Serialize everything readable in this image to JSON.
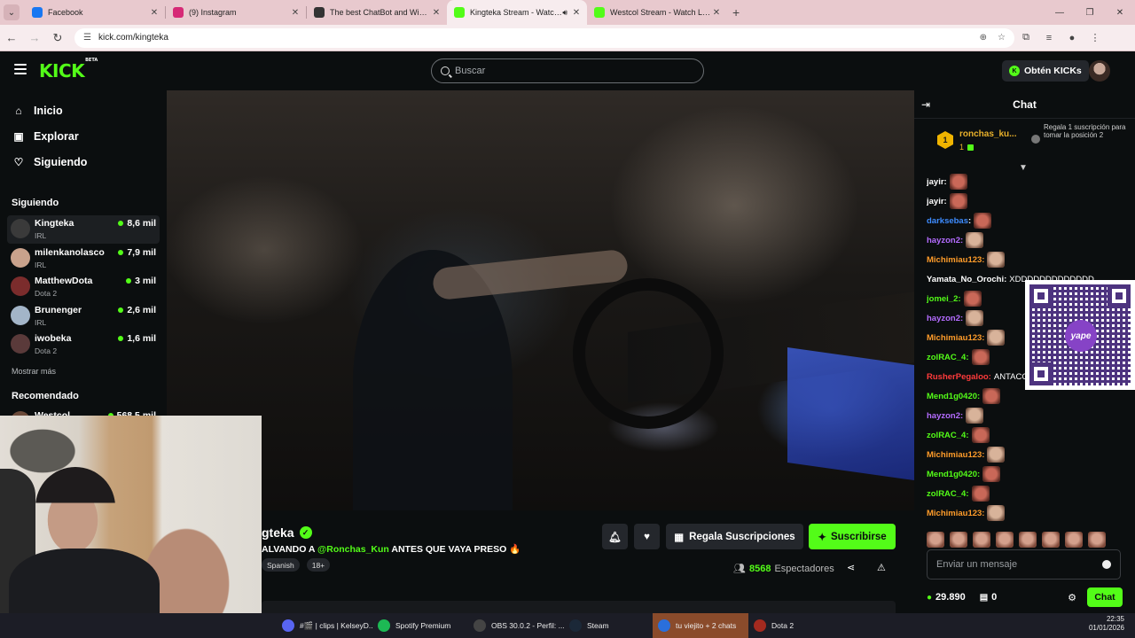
{
  "browser": {
    "tabs": [
      {
        "title": "Facebook",
        "color": "#1877f2"
      },
      {
        "title": "(9) Instagram",
        "color": "#d62976"
      },
      {
        "title": "The best ChatBot and Widgets",
        "color": "#333333"
      },
      {
        "title": "Kingteka Stream - Watch Li",
        "color": "#53fc18",
        "active": true
      },
      {
        "title": "Westcol Stream - Watch Live o",
        "color": "#53fc18"
      }
    ],
    "url": "kick.com/kingteka"
  },
  "header": {
    "logo": "KICK",
    "logo_badge": "BETA",
    "search_placeholder": "Buscar",
    "kicks_label": "Obtén KICKs"
  },
  "sidebar": {
    "nav": [
      {
        "label": "Inicio",
        "icon": "home-icon"
      },
      {
        "label": "Explorar",
        "icon": "compass-icon"
      },
      {
        "label": "Siguiendo",
        "icon": "heart-icon"
      }
    ],
    "following_title": "Siguiendo",
    "following": [
      {
        "name": "Kingteka",
        "category": "IRL",
        "viewers": "8,6 mil"
      },
      {
        "name": "milenkanolasco",
        "category": "IRL",
        "viewers": "7,9 mil"
      },
      {
        "name": "MatthewDota",
        "category": "Dota 2",
        "viewers": "3 mil"
      },
      {
        "name": "Brunenger",
        "category": "IRL",
        "viewers": "2,6 mil"
      },
      {
        "name": "iwobeka",
        "category": "Dota 2",
        "viewers": "1,6 mil"
      }
    ],
    "show_more": "Mostrar más",
    "recommended_title": "Recomendado",
    "recommended": [
      {
        "name": "Westcol",
        "viewers": "568,5 mil"
      }
    ]
  },
  "stream": {
    "name": "Kingteka",
    "name_visible": "gteka",
    "title_prefix": "ALVANDO A",
    "mention": "@Ronchas_Kun",
    "title_suffix": "ANTES QUE VAYA PRESO 🔥",
    "tags": [
      "Spanish",
      "18+"
    ],
    "gift_label": "Regala Suscripciones",
    "subscribe_label": "Suscribirse",
    "viewers": "8568",
    "viewers_label": "Espectadores"
  },
  "chat": {
    "title": "Chat",
    "pinned": {
      "rank": "1",
      "user": "ronchas_ku...",
      "count": "1",
      "gift_text": "Regala 1 suscripción para tomar la posición 2"
    },
    "messages": [
      {
        "user": "jayir:",
        "color": "#ffffff",
        "text": "",
        "emote": "red"
      },
      {
        "user": "jayir:",
        "color": "#ffffff",
        "text": "",
        "emote": "red"
      },
      {
        "user": "darksebas",
        "color": "#3e8cff",
        "text": "",
        "emote": "red",
        "sep": ":"
      },
      {
        "user": "hayzon2:",
        "color": "#b46cff",
        "text": "",
        "emote": "face"
      },
      {
        "user": "Michimiau123:",
        "color": "#ff9c2a",
        "text": "",
        "emote": "face"
      },
      {
        "user": "Yamata_No_Orochi:",
        "color": "#ffffff",
        "text": "XDDDDDDDDDDDDD",
        "emote": ""
      },
      {
        "user": "jomei_2:",
        "color": "#53fc18",
        "text": "",
        "emote": "red"
      },
      {
        "user": "hayzon2:",
        "color": "#b46cff",
        "text": "",
        "emote": "face"
      },
      {
        "user": "Michimiau123:",
        "color": "#ff9c2a",
        "text": "",
        "emote": "face"
      },
      {
        "user": "zolRAC_4:",
        "color": "#53fc18",
        "text": "",
        "emote": "red"
      },
      {
        "user": "RusherPegaloo:",
        "color": "#ff3b3b",
        "text": "ANTACO",
        "emote": ""
      },
      {
        "user": "Mend1g0420:",
        "color": "#53fc18",
        "text": "",
        "emote": "red"
      },
      {
        "user": "hayzon2:",
        "color": "#b46cff",
        "text": "",
        "emote": "face"
      },
      {
        "user": "zolRAC_4:",
        "color": "#53fc18",
        "text": "",
        "emote": "red"
      },
      {
        "user": "Michimiau123:",
        "color": "#ff9c2a",
        "text": "",
        "emote": "face"
      },
      {
        "user": "Mend1g0420:",
        "color": "#53fc18",
        "text": "",
        "emote": "red"
      },
      {
        "user": "zolRAC_4:",
        "color": "#53fc18",
        "text": "",
        "emote": "red"
      },
      {
        "user": "Michimiau123:",
        "color": "#ff9c2a",
        "text": "",
        "emote": "face"
      }
    ],
    "qr_label": "yape",
    "input_placeholder": "Enviar un mensaje",
    "points": "29.890",
    "gifts": "0",
    "send_label": "Chat"
  },
  "taskbar": {
    "items": [
      {
        "label": "#🎬 | clips | KelseyD...",
        "color": "#5865f2"
      },
      {
        "label": "Spotify Premium",
        "color": "#1db954"
      },
      {
        "label": "OBS 30.0.2 - Perfil: ...",
        "color": "#444444"
      },
      {
        "label": "Steam",
        "color": "#1b2838"
      },
      {
        "label": "tu viejito + 2 chats",
        "color": "#2a6fdb",
        "active": true
      },
      {
        "label": "Dota 2",
        "color": "#a32a1f"
      }
    ],
    "time": "22:35",
    "date": "01/01/2026"
  },
  "colors": {
    "accent": "#53fc18",
    "background": "#0b0e0f"
  }
}
